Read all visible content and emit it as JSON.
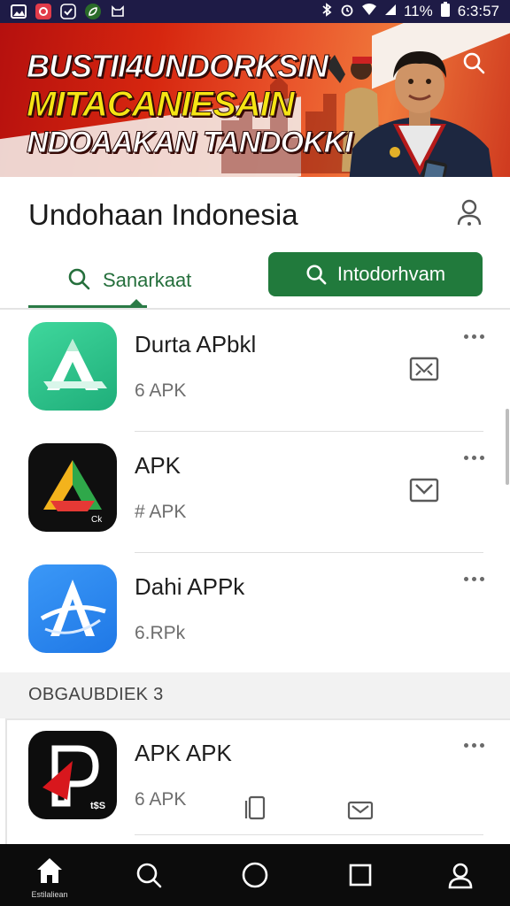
{
  "status_bar": {
    "battery": "11%",
    "time": "6:3:57"
  },
  "banner": {
    "line1": "BUSTII4UNDORKSIN",
    "line2": "MITACANIESAIN",
    "line3": "NDOAAKAN TANDOKKI"
  },
  "header": {
    "title": "Undohaan Indonesia",
    "tab_left_label": "Sanarkaat",
    "tab_right_label": "Intodorhvam"
  },
  "apps": [
    {
      "name": "Durta APbkl",
      "sub": "6 APK",
      "tile_color": "#2fc58e",
      "icon": "triangle-a-icon"
    },
    {
      "name": "APK",
      "sub": "# APK",
      "tile_color": "#0f0f0f",
      "icon": "green-yellow-a-icon",
      "badge": "Ck"
    },
    {
      "name": "Dahi APPk",
      "sub": "6.RPk",
      "tile_color": "#2d8af0",
      "icon": "blue-a-icon"
    }
  ],
  "section": {
    "label": "OBGAUBDIEK 3"
  },
  "featured": {
    "name": "APK APK",
    "sub": "6 APK",
    "tile_color": "#0d0d0d",
    "icon": "red-p-icon",
    "badge": "t$S"
  },
  "bottom_nav": {
    "home_label": "Estilaliean"
  }
}
